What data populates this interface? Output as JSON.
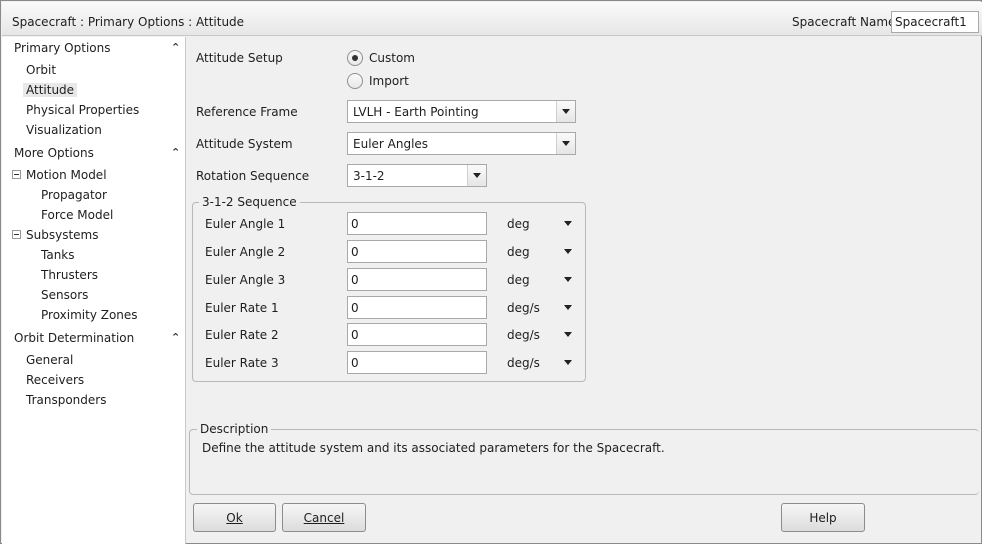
{
  "header": {
    "breadcrumb": "Spacecraft : Primary Options : Attitude",
    "spacecraft_name_label": "Spacecraft Name",
    "spacecraft_name_value": "Spacecraft1"
  },
  "sidebar": {
    "primary_options": "Primary Options",
    "orbit": "Orbit",
    "attitude": "Attitude",
    "physical_properties": "Physical Properties",
    "visualization": "Visualization",
    "more_options": "More Options",
    "motion_model": "Motion Model",
    "propagator": "Propagator",
    "force_model": "Force Model",
    "subsystems": "Subsystems",
    "tanks": "Tanks",
    "thrusters": "Thrusters",
    "sensors": "Sensors",
    "proximity_zones": "Proximity Zones",
    "orbit_determination": "Orbit Determination",
    "general": "General",
    "receivers": "Receivers",
    "transponders": "Transponders"
  },
  "form": {
    "attitude_setup_label": "Attitude Setup",
    "custom_label": "Custom",
    "import_label": "Import",
    "reference_frame_label": "Reference Frame",
    "reference_frame_value": "LVLH - Earth Pointing",
    "attitude_system_label": "Attitude System",
    "attitude_system_value": "Euler Angles",
    "rotation_sequence_label": "Rotation Sequence",
    "rotation_sequence_value": "3-1-2",
    "sequence_group_title": "3-1-2 Sequence",
    "rows": [
      {
        "label": "Euler Angle 1",
        "value": "0",
        "unit": "deg"
      },
      {
        "label": "Euler Angle 2",
        "value": "0",
        "unit": "deg"
      },
      {
        "label": "Euler Angle 3",
        "value": "0",
        "unit": "deg"
      },
      {
        "label": "Euler Rate 1",
        "value": "0",
        "unit": "deg/s"
      },
      {
        "label": "Euler Rate 2",
        "value": "0",
        "unit": "deg/s"
      },
      {
        "label": "Euler Rate 3",
        "value": "0",
        "unit": "deg/s"
      }
    ]
  },
  "description": {
    "title": "Description",
    "text": "Define the attitude system and its associated parameters for the Spacecraft."
  },
  "buttons": {
    "ok": "Ok",
    "cancel": "Cancel",
    "help": "Help"
  }
}
